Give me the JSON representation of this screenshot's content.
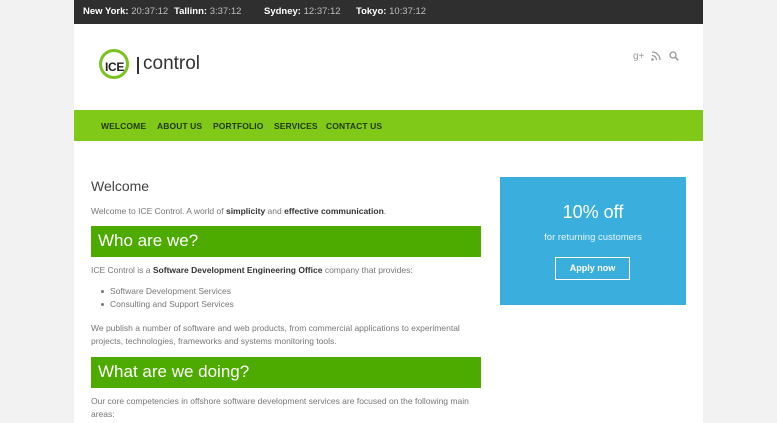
{
  "topbar": {
    "clocks": [
      {
        "city": "New York:",
        "time": "20:37:12"
      },
      {
        "city": "Tallinn:",
        "time": "3:37:12"
      },
      {
        "city": "Sydney:",
        "time": "12:37:12"
      },
      {
        "city": "Tokyo:",
        "time": "10:37:12"
      }
    ]
  },
  "header": {
    "logo_ice": "ICE",
    "logo_control": "control",
    "icons": [
      "google-plus-icon",
      "rss-icon",
      "search-icon"
    ],
    "icon_glyphs": [
      "g+",
      "≡",
      "⚲"
    ]
  },
  "nav": {
    "items": [
      "WELCOME",
      "ABOUT US",
      "PORTFOLIO",
      "SERVICES",
      "CONTACT US"
    ]
  },
  "colors": {
    "nav_bg": "#80c919",
    "section_head_bg": "#4dab00",
    "promo_bg": "#3aaedc",
    "topbar_bg": "#2f2f2f"
  },
  "content": {
    "welcome_title": "Welcome",
    "welcome_intro_1": "Welcome to ICE Control. A world of ",
    "welcome_intro_b1": "simplicity",
    "welcome_intro_2": " and ",
    "welcome_intro_b2": "effective communication",
    "welcome_intro_3": ".",
    "who_title": "Who are we?",
    "who_text_1": "ICE Control is a ",
    "who_text_b": "Software Development Engineering Office",
    "who_text_2": " company that provides:",
    "who_list": [
      "Software Development Services",
      "Consulting and Support Services"
    ],
    "publish_text": "We publish a number of software and web products, from commercial applications to experimental projects, technologies, frameworks and systems monitoring tools.",
    "doing_title": "What are we doing?",
    "doing_text": "Our core competencies in offshore software development services are focused on the following main areas:"
  },
  "promo": {
    "title": "10% off",
    "subtitle": "for returning customers",
    "button": "Apply now"
  }
}
